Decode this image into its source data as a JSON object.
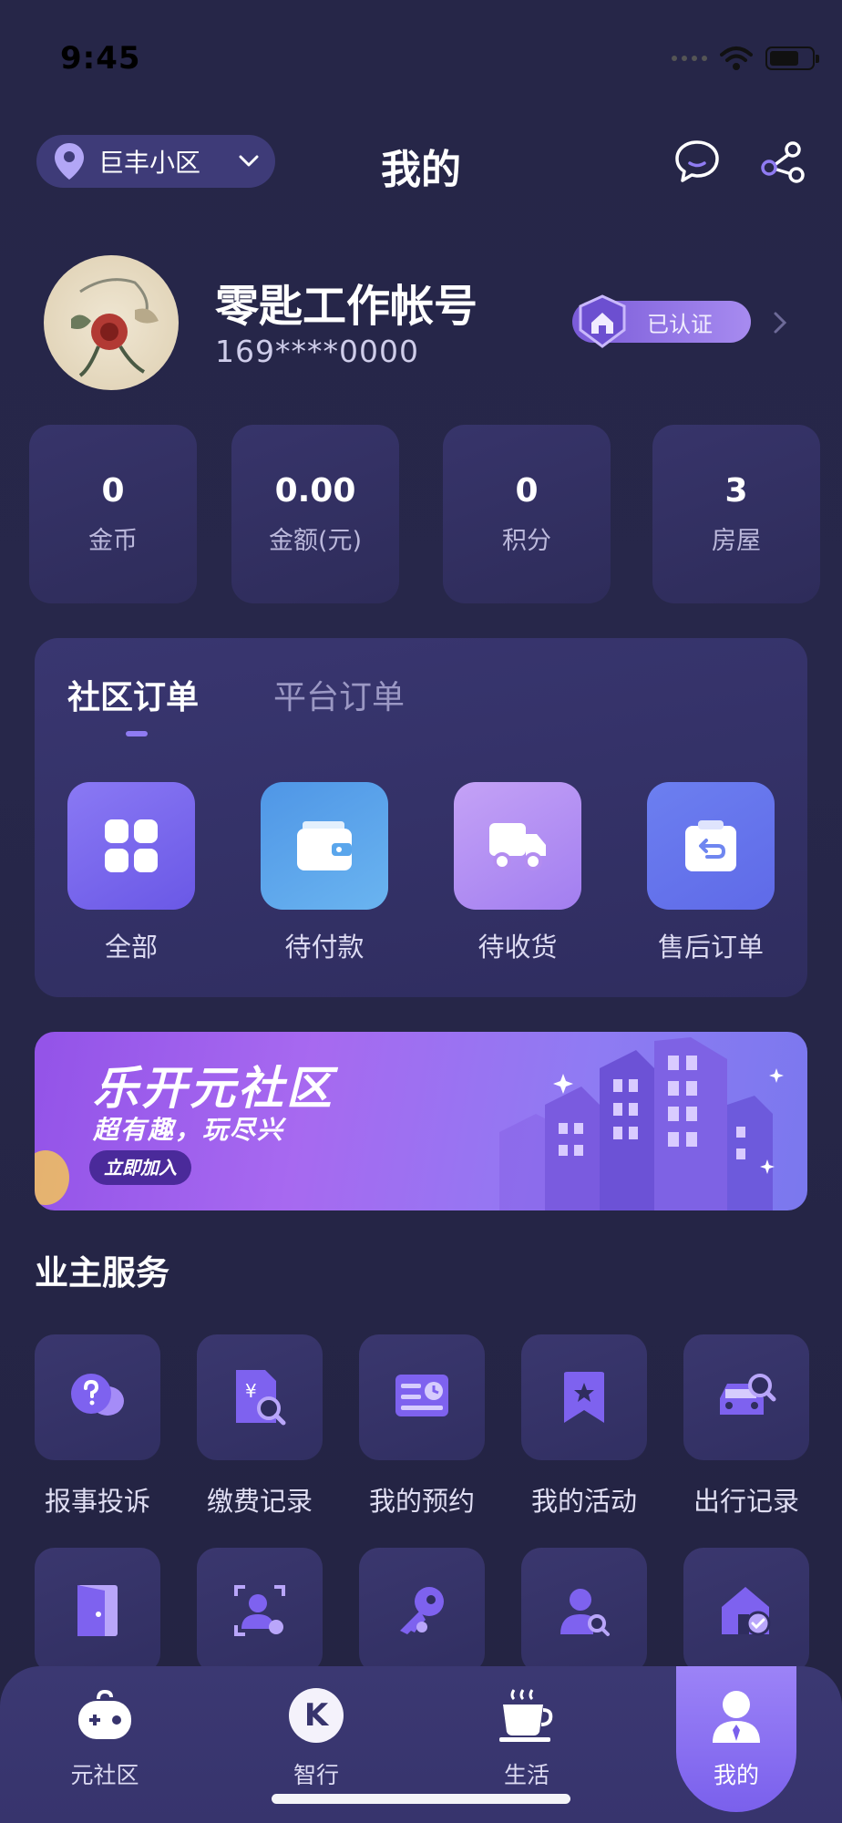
{
  "status_bar": {
    "time": "9:45"
  },
  "header": {
    "location": "巨丰小区",
    "title": "我的"
  },
  "profile": {
    "name": "零匙工作帐号",
    "phone": "169****0000",
    "verified_label": "已认证"
  },
  "stats": [
    {
      "value": "0",
      "label": "金币"
    },
    {
      "value": "0.00",
      "label": "金额(元)"
    },
    {
      "value": "0",
      "label": "积分"
    },
    {
      "value": "3",
      "label": "房屋"
    }
  ],
  "orders": {
    "tabs": [
      {
        "label": "社区订单",
        "active": true
      },
      {
        "label": "平台订单",
        "active": false
      }
    ],
    "items": [
      {
        "label": "全部",
        "icon": "grid-icon",
        "color": "#7c6cf0"
      },
      {
        "label": "待付款",
        "icon": "wallet-icon",
        "color": "#5aa6ec"
      },
      {
        "label": "待收货",
        "icon": "truck-icon",
        "color": "#b38cf0"
      },
      {
        "label": "售后订单",
        "icon": "return-box-icon",
        "color": "#6f86f0"
      }
    ]
  },
  "banner": {
    "title": "乐开元社区",
    "subtitle": "超有趣，玩尽兴",
    "button": "立即加入"
  },
  "services": {
    "title": "业主服务",
    "items": [
      {
        "label": "报事投诉",
        "icon": "question-chat-icon"
      },
      {
        "label": "缴费记录",
        "icon": "bill-search-icon"
      },
      {
        "label": "我的预约",
        "icon": "appointment-icon"
      },
      {
        "label": "我的活动",
        "icon": "star-bookmark-icon"
      },
      {
        "label": "出行记录",
        "icon": "car-search-icon"
      },
      {
        "label": "",
        "icon": "door-icon"
      },
      {
        "label": "",
        "icon": "face-scan-icon"
      },
      {
        "label": "",
        "icon": "key-icon"
      },
      {
        "label": "",
        "icon": "person-search-icon"
      },
      {
        "label": "",
        "icon": "house-check-icon"
      }
    ]
  },
  "tabbar": [
    {
      "label": "元社区",
      "icon": "gamepad-icon"
    },
    {
      "label": "智行",
      "icon": "k-circle-icon",
      "glyph": "K"
    },
    {
      "label": "生活",
      "icon": "coffee-cup-icon"
    },
    {
      "label": "我的",
      "icon": "user-icon",
      "active": true
    }
  ],
  "colors": {
    "accent": "#8f7bf2",
    "background": "#262648",
    "card": "#37346a"
  }
}
